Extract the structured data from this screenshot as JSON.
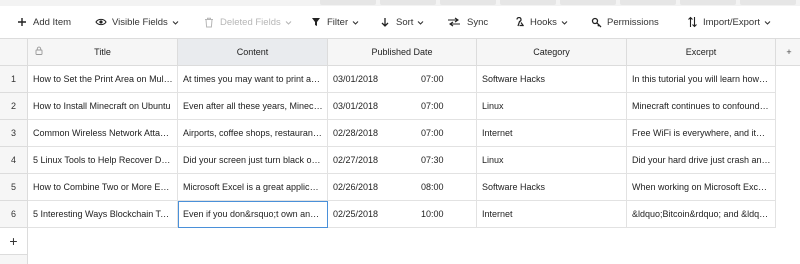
{
  "toolbar": {
    "add_item": "Add Item",
    "visible_fields": "Visible Fields",
    "deleted_fields": "Deleted Fields",
    "filter": "Filter",
    "sort": "Sort",
    "sync": "Sync",
    "hooks": "Hooks",
    "permissions": "Permissions",
    "import_export": "Import/Export"
  },
  "columns": {
    "title": "Title",
    "content": "Content",
    "published_date": "Published Date",
    "category": "Category",
    "excerpt": "Excerpt"
  },
  "rows": [
    {
      "num": "1",
      "title": "How to Set the Print Area on Mul…",
      "content": "At times you may want to print a…",
      "date": "03/01/2018",
      "time": "07:00",
      "category": "Software Hacks",
      "excerpt": "In this tutorial you will learn how…"
    },
    {
      "num": "2",
      "title": "How to Install Minecraft on Ubuntu",
      "content": "Even after all these years, Minecr…",
      "date": "03/01/2018",
      "time": "07:00",
      "category": "Linux",
      "excerpt": "Minecraft continues to confound…"
    },
    {
      "num": "3",
      "title": "Common Wireless Network Atta…",
      "content": "Airports, coffee shops, restauran…",
      "date": "02/28/2018",
      "time": "07:00",
      "category": "Internet",
      "excerpt": "Free WiFi is everywhere, and it&r…"
    },
    {
      "num": "4",
      "title": "5 Linux Tools to Help Recover D…",
      "content": "Did your screen just turn black o…",
      "date": "02/27/2018",
      "time": "07:30",
      "category": "Linux",
      "excerpt": "Did your hard drive just crash an…"
    },
    {
      "num": "5",
      "title": "How to Combine Two or More Ex…",
      "content": "Microsoft Excel is a great applica…",
      "date": "02/26/2018",
      "time": "08:00",
      "category": "Software Hacks",
      "excerpt": "When working on Microsoft Exc…"
    },
    {
      "num": "6",
      "title": "5 Interesting Ways Blockchain Te…",
      "content": "Even if you don&rsquo;t own an…",
      "date": "02/25/2018",
      "time": "10:00",
      "category": "Internet",
      "excerpt": "&ldquo;Bitcoin&rdquo; and &ldq…"
    }
  ],
  "add_row_symbol": "+",
  "add_column_symbol": "+",
  "icons": {
    "add_item": "plus-icon",
    "visible_fields": "eye-icon",
    "deleted_fields": "trash-icon",
    "filter": "funnel-icon",
    "sort": "arrow-down-icon",
    "sync": "sync-arrows-icon",
    "hooks": "hook-icon",
    "permissions": "key-icon",
    "import_export": "import-export-icon",
    "title_column": "lock-icon"
  },
  "colors": {
    "active_cell_border": "#4a90d9",
    "selected_header": "#e9ebee",
    "disabled_text": "#b6b6b6"
  }
}
